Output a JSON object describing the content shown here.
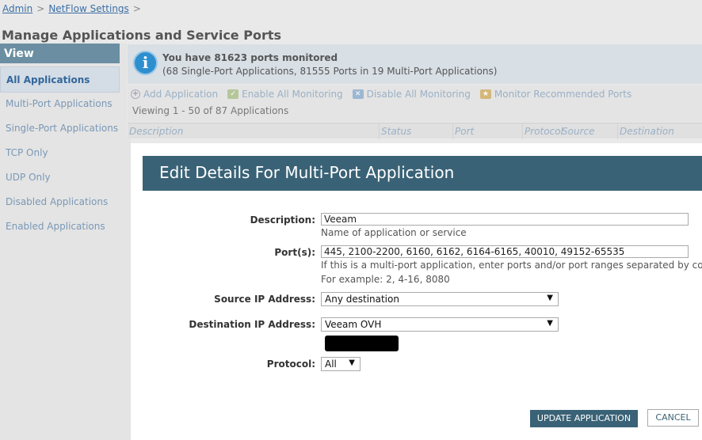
{
  "breadcrumb": {
    "items": [
      "Admin",
      "NetFlow Settings"
    ],
    "separator": ">"
  },
  "page_title": "Manage Applications and Service Ports",
  "sidebar": {
    "header": "View",
    "items": [
      {
        "label": "All Applications",
        "active": true
      },
      {
        "label": "Multi-Port Applications"
      },
      {
        "label": "Single-Port Applications"
      },
      {
        "label": "TCP Only"
      },
      {
        "label": "UDP Only"
      },
      {
        "label": "Disabled Applications"
      },
      {
        "label": "Enabled Applications"
      }
    ]
  },
  "banner": {
    "icon": "info-icon",
    "title": "You have 81623 ports monitored",
    "subtitle": "(68 Single-Port Applications, 81555 Ports in 19 Multi-Port Applications)"
  },
  "toolbar": {
    "add": "Add Application",
    "enable_all": "Enable All Monitoring",
    "disable_all": "Disable All Monitoring",
    "monitor_recommended": "Monitor Recommended Ports",
    "viewing": "Viewing 1 - 50 of 87 Applications"
  },
  "grid": {
    "columns": [
      "Description",
      "Status",
      "Port",
      "Protocol",
      "Source",
      "Destination"
    ]
  },
  "modal": {
    "title": "Edit Details For Multi-Port Application",
    "description": {
      "label": "Description:",
      "value": "Veeam",
      "hint": "Name of application or service"
    },
    "ports": {
      "label": "Port(s):",
      "value": "445, 2100-2200, 6160, 6162, 6164-6165, 40010, 49152-65535",
      "hint1": "If this is a multi-port application, enter ports and/or port ranges separated by commas",
      "hint2": "For example: 2, 4-16, 8080"
    },
    "source_ip": {
      "label": "Source IP Address:",
      "value": "Any destination"
    },
    "destination_ip": {
      "label": "Destination IP Address:",
      "value": "Veeam OVH"
    },
    "protocol": {
      "label": "Protocol:",
      "value": "All"
    },
    "update_button": "UPDATE APPLICATION",
    "cancel_button": "CANCEL"
  },
  "colors": {
    "accent": "#3a6276",
    "link": "#3b6fa6",
    "sidebar_header": "#6b8ea2",
    "info": "#2e8fcf"
  }
}
